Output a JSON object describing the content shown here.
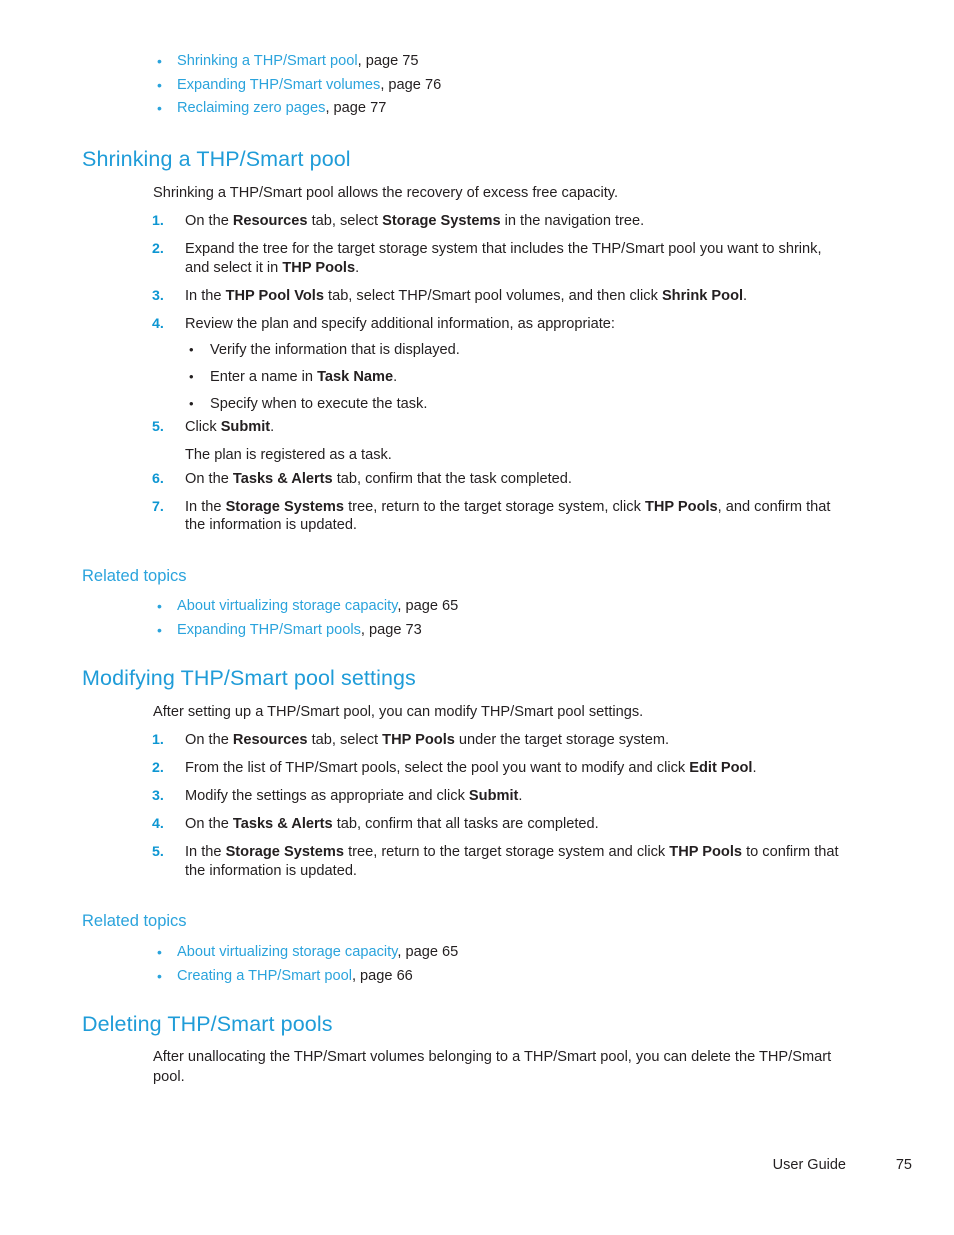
{
  "page": {
    "footer_label": "User Guide",
    "footer_page_number": "75",
    "accent_heading_color": "#1f9cd8",
    "accent_link_color": "#2aa3dc",
    "accent_number_color": "#0d96d2",
    "body_color": "#231f20",
    "background_color": "#ffffff"
  },
  "top_xref_list": {
    "bullet_glyph": "•",
    "items": [
      {
        "link": "Shrinking a THP/Smart pool",
        "page": ", page 75"
      },
      {
        "link": "Expanding THP/Smart volumes",
        "page": ", page 76"
      },
      {
        "link": "Reclaiming zero pages",
        "page": ", page 77"
      }
    ]
  },
  "section_shrinking": {
    "title": "Shrinking a THP/Smart pool",
    "intro": "Shrinking a THP/Smart pool allows the recovery of excess free capacity.",
    "steps": [
      {
        "num": "1.",
        "html": "On the <b>Resources</b> tab, select <b>Storage Systems</b> in the navigation tree."
      },
      {
        "num": "2.",
        "html": "Expand the tree for the target storage system that includes the THP/Smart pool you want to shrink, and select it in <b>THP Pools</b>."
      },
      {
        "num": "3.",
        "html": "In the <b>THP Pool Vols</b> tab, select THP/Smart pool volumes, and then click <b>Shrink Pool</b>."
      },
      {
        "num": "4.",
        "html": "Review the plan and specify additional information, as appropriate:"
      },
      {
        "num": "5.",
        "html": "Click <b>Submit</b>."
      },
      {
        "num": "6.",
        "html": "On the <b>Tasks &amp; Alerts</b> tab, confirm that the task completed."
      },
      {
        "num": "7.",
        "html": "In the <b>Storage Systems</b> tree, return to the target storage system, click <b>THP Pools</b>, and confirm that the information is updated."
      }
    ],
    "step4_sub_bullets": {
      "bullet_glyph": "•",
      "items": [
        {
          "html": "Verify the information that is displayed."
        },
        {
          "html": "Enter a name in <b>Task Name</b>."
        },
        {
          "html": "Specify when to execute the task."
        }
      ]
    },
    "step5_note": "The plan is registered as a task."
  },
  "related_topics_1": {
    "title": "Related topics",
    "bullet_glyph": "•",
    "items": [
      {
        "link": "About virtualizing storage capacity",
        "page": ", page 65"
      },
      {
        "link": "Expanding THP/Smart pools",
        "page": ", page 73"
      }
    ]
  },
  "section_modifying": {
    "title": "Modifying THP/Smart pool settings",
    "intro": "After setting up a THP/Smart pool, you can modify THP/Smart pool settings.",
    "steps": [
      {
        "num": "1.",
        "html": "On the <b>Resources</b> tab, select <b>THP Pools</b> under the target storage system."
      },
      {
        "num": "2.",
        "html": "From the list of THP/Smart pools, select the pool you want to modify and click <b>Edit Pool</b>."
      },
      {
        "num": "3.",
        "html": "Modify the settings as appropriate and click <b>Submit</b>."
      },
      {
        "num": "4.",
        "html": "On the <b>Tasks &amp; Alerts</b> tab, confirm that all tasks are completed."
      },
      {
        "num": "5.",
        "html": "In the <b>Storage Systems</b> tree, return to the target storage system and click <b>THP Pools</b> to confirm that the information is updated."
      }
    ]
  },
  "related_topics_2": {
    "title": "Related topics",
    "bullet_glyph": "•",
    "items": [
      {
        "link": "About virtualizing storage capacity",
        "page": ", page 65"
      },
      {
        "link": "Creating a THP/Smart pool",
        "page": ", page 66"
      }
    ]
  },
  "section_deleting": {
    "title": "Deleting THP/Smart pools",
    "intro": "After unallocating the THP/Smart volumes belonging to a THP/Smart pool, you can delete the THP/Smart pool."
  }
}
